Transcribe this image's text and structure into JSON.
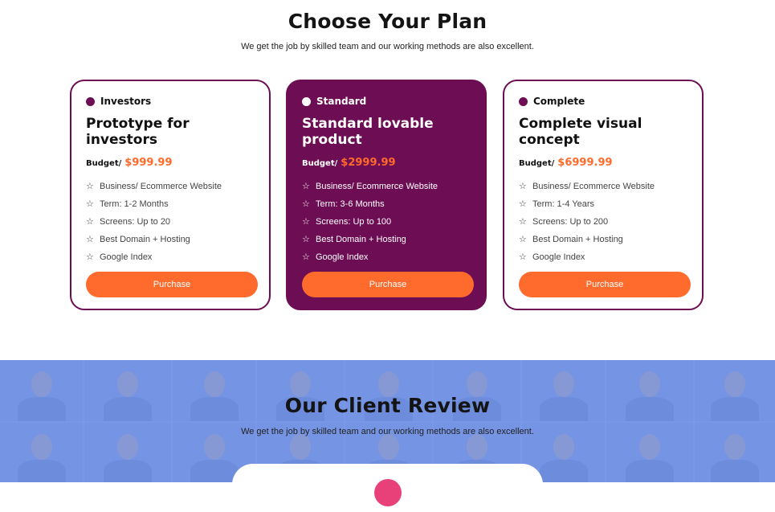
{
  "pricing": {
    "title": "Choose Your Plan",
    "subtitle": "We get the job by skilled team and our working methods are also excellent."
  },
  "plans": [
    {
      "name": "Investors",
      "title": "Prototype for investors",
      "budget_label": "Budget/",
      "price": "$999.99",
      "features": [
        "Business/ Ecommerce Website",
        "Term: 1-2 Months",
        "Screens: Up to 20",
        "Best Domain + Hosting",
        "Google Index"
      ],
      "button": "Purchase"
    },
    {
      "name": "Standard",
      "title": "Standard lovable product",
      "budget_label": "Budget/",
      "price": "$2999.99",
      "features": [
        "Business/ Ecommerce Website",
        "Term: 3-6 Months",
        "Screens: Up to 100",
        "Best Domain + Hosting",
        "Google Index"
      ],
      "button": "Purchase"
    },
    {
      "name": "Complete",
      "title": "Complete visual concept",
      "budget_label": "Budget/",
      "price": "$6999.99",
      "features": [
        "Business/ Ecommerce Website",
        "Term: 1-4 Years",
        "Screens: Up to 200",
        "Best Domain + Hosting",
        "Google Index"
      ],
      "button": "Purchase"
    }
  ],
  "reviews": {
    "title": "Our Client Review",
    "subtitle": "We get the job by skilled team and our working methods are also excellent."
  },
  "colors": {
    "brand": "#6d0d53",
    "accent": "#fe6b2c",
    "review_band": "#7f9ce6"
  },
  "icons": {
    "feature_bullet": "star-outline-icon",
    "plan_marker": "dot-icon"
  }
}
